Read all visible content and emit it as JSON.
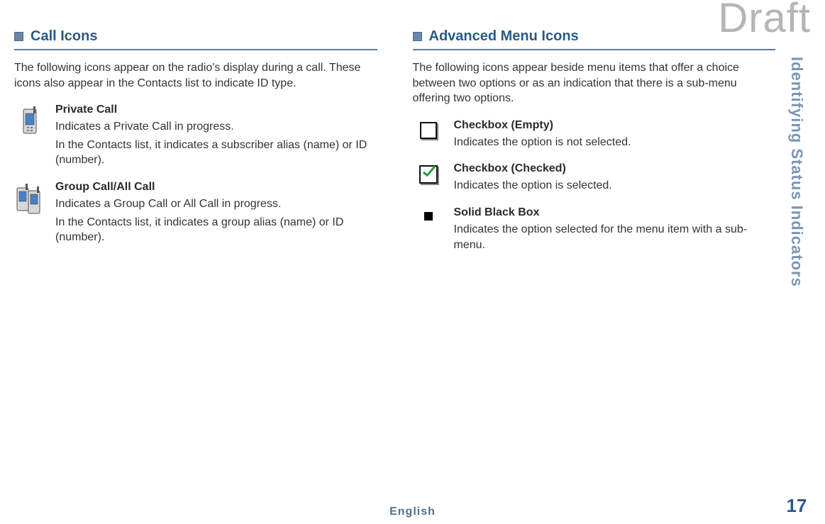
{
  "watermark": "Draft",
  "side_label": "Identifying Status Indicators",
  "page_number": "17",
  "footer_lang": "English",
  "left": {
    "heading": "Call Icons",
    "intro": "The following icons appear on the radio's display during a call. These icons also appear in the Contacts list to indicate ID type.",
    "items": [
      {
        "title": "Private Call",
        "desc": "Indicates a Private Call in progress.",
        "desc2": "In the Contacts list, it indicates a subscriber alias (name) or ID (number)."
      },
      {
        "title": "Group Call/All Call",
        "desc": "Indicates a Group Call or All Call in progress.",
        "desc2": "In the Contacts list, it indicates a group alias (name) or ID (number)."
      }
    ]
  },
  "right": {
    "heading": "Advanced Menu Icons",
    "intro": "The following icons appear beside menu items that offer a choice between two options or as an indication that there is a sub-menu offering two options.",
    "items": [
      {
        "title": "Checkbox (Empty)",
        "desc": "Indicates the option is not selected."
      },
      {
        "title": "Checkbox (Checked)",
        "desc": "Indicates the option is selected."
      },
      {
        "title": "Solid Black Box",
        "desc": "Indicates the option selected for the menu item with a sub-menu."
      }
    ]
  }
}
